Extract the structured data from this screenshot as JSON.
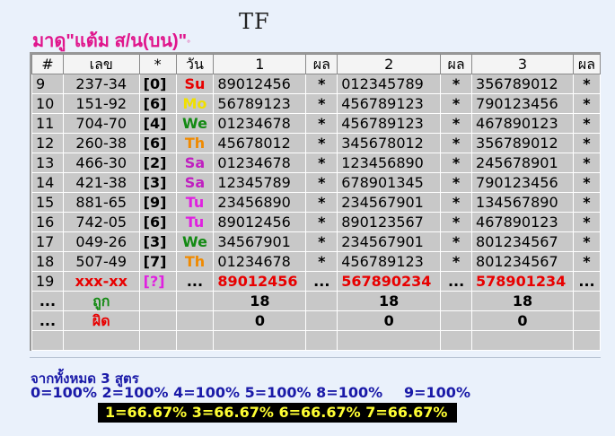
{
  "header": {
    "title_main": "มาดู\"แต้ม ส/น(บน)\"",
    "title_tail": "◦",
    "logo_text": "TF"
  },
  "table": {
    "columns": [
      "#",
      "เลข",
      "*",
      "วัน",
      "1",
      "ผล",
      "2",
      "ผล",
      "3",
      "ผล"
    ],
    "rows": [
      {
        "idx": "9",
        "lek": "237-34",
        "code": "[0]",
        "day": "Su",
        "day_color": "#e80000",
        "n1": "89012456",
        "r1": "*",
        "n2": "012345789",
        "r2": "*",
        "n3": "356789012",
        "r3": "*"
      },
      {
        "idx": "10",
        "lek": "151-92",
        "code": "[6]",
        "day": "Mo",
        "day_color": "#f0e000",
        "n1": "56789123",
        "r1": "*",
        "n2": "456789123",
        "r2": "*",
        "n3": "790123456",
        "r3": "*"
      },
      {
        "idx": "11",
        "lek": "704-70",
        "code": "[4]",
        "day": "We",
        "day_color": "#138a13",
        "n1": "01234678",
        "r1": "*",
        "n2": "456789123",
        "r2": "*",
        "n3": "467890123",
        "r3": "*"
      },
      {
        "idx": "12",
        "lek": "260-38",
        "code": "[6]",
        "day": "Th",
        "day_color": "#f08a00",
        "n1": "45678012",
        "r1": "*",
        "n2": "345678012",
        "r2": "*",
        "n3": "356789012",
        "r3": "*"
      },
      {
        "idx": "13",
        "lek": "466-30",
        "code": "[2]",
        "day": "Sa",
        "day_color": "#c020c0",
        "n1": "01234678",
        "r1": "*",
        "n2": "123456890",
        "r2": "*",
        "n3": "245678901",
        "r3": "*"
      },
      {
        "idx": "14",
        "lek": "421-38",
        "code": "[3]",
        "day": "Sa",
        "day_color": "#c020c0",
        "n1": "12345789",
        "r1": "*",
        "n2": "678901345",
        "r2": "*",
        "n3": "790123456",
        "r3": "*"
      },
      {
        "idx": "15",
        "lek": "881-65",
        "code": "[9]",
        "day": "Tu",
        "day_color": "#e020e0",
        "n1": "23456890",
        "r1": "*",
        "n2": "234567901",
        "r2": "*",
        "n3": "134567890",
        "r3": "*"
      },
      {
        "idx": "16",
        "lek": "742-05",
        "code": "[6]",
        "day": "Tu",
        "day_color": "#e020e0",
        "n1": "89012456",
        "r1": "*",
        "n2": "890123567",
        "r2": "*",
        "n3": "467890123",
        "r3": "*"
      },
      {
        "idx": "17",
        "lek": "049-26",
        "code": "[3]",
        "day": "We",
        "day_color": "#138a13",
        "n1": "34567901",
        "r1": "*",
        "n2": "234567901",
        "r2": "*",
        "n3": "801234567",
        "r3": "*"
      },
      {
        "idx": "18",
        "lek": "507-49",
        "code": "[7]",
        "day": "Th",
        "day_color": "#f08a00",
        "n1": "01234678",
        "r1": "*",
        "n2": "456789123",
        "r2": "*",
        "n3": "801234567",
        "r3": "*"
      }
    ],
    "pred_row": {
      "idx": "19",
      "lek": "xxx-xx",
      "code": "[?]",
      "day": "...",
      "n1": "89012456",
      "r1": "...",
      "n2": "567890234",
      "r2": "...",
      "n3": "578901234",
      "r3": "..."
    },
    "ok_row": {
      "dots": "...",
      "label": "ถูก",
      "v1": "18",
      "v2": "18",
      "v3": "18"
    },
    "bad_row": {
      "dots": "...",
      "label": "ผิด",
      "v1": "0",
      "v2": "0",
      "v3": "0"
    }
  },
  "summary": {
    "heading": "จากทั้งหมด 3 สูตร",
    "pct_blue": "0=100% 2=100% 4=100% 5=100% 8=100%",
    "pct_extra": "9=100%",
    "pct_black": "1=66.67% 3=66.67% 6=66.67% 7=66.67%"
  },
  "colors": {
    "accent_pink": "#e0158c",
    "accent_blue": "#1a1aa8",
    "hit_red": "#e80000",
    "ok_green": "#2aa02a"
  }
}
